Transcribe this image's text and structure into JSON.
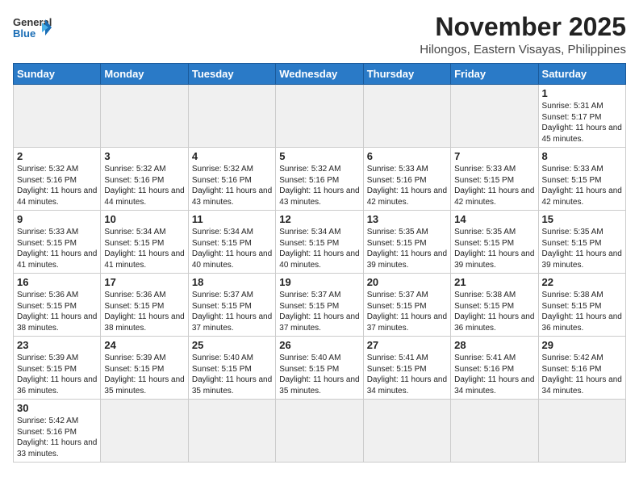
{
  "logo": {
    "general": "General",
    "blue": "Blue"
  },
  "title": "November 2025",
  "location": "Hilongos, Eastern Visayas, Philippines",
  "days_of_week": [
    "Sunday",
    "Monday",
    "Tuesday",
    "Wednesday",
    "Thursday",
    "Friday",
    "Saturday"
  ],
  "weeks": [
    [
      {
        "day": "",
        "empty": true
      },
      {
        "day": "",
        "empty": true
      },
      {
        "day": "",
        "empty": true
      },
      {
        "day": "",
        "empty": true
      },
      {
        "day": "",
        "empty": true
      },
      {
        "day": "",
        "empty": true
      },
      {
        "day": "1",
        "sunrise": "Sunrise: 5:31 AM",
        "sunset": "Sunset: 5:17 PM",
        "daylight": "Daylight: 11 hours and 45 minutes."
      }
    ],
    [
      {
        "day": "2",
        "sunrise": "Sunrise: 5:32 AM",
        "sunset": "Sunset: 5:16 PM",
        "daylight": "Daylight: 11 hours and 44 minutes."
      },
      {
        "day": "3",
        "sunrise": "Sunrise: 5:32 AM",
        "sunset": "Sunset: 5:16 PM",
        "daylight": "Daylight: 11 hours and 44 minutes."
      },
      {
        "day": "4",
        "sunrise": "Sunrise: 5:32 AM",
        "sunset": "Sunset: 5:16 PM",
        "daylight": "Daylight: 11 hours and 43 minutes."
      },
      {
        "day": "5",
        "sunrise": "Sunrise: 5:32 AM",
        "sunset": "Sunset: 5:16 PM",
        "daylight": "Daylight: 11 hours and 43 minutes."
      },
      {
        "day": "6",
        "sunrise": "Sunrise: 5:33 AM",
        "sunset": "Sunset: 5:16 PM",
        "daylight": "Daylight: 11 hours and 42 minutes."
      },
      {
        "day": "7",
        "sunrise": "Sunrise: 5:33 AM",
        "sunset": "Sunset: 5:15 PM",
        "daylight": "Daylight: 11 hours and 42 minutes."
      },
      {
        "day": "8",
        "sunrise": "Sunrise: 5:33 AM",
        "sunset": "Sunset: 5:15 PM",
        "daylight": "Daylight: 11 hours and 42 minutes."
      }
    ],
    [
      {
        "day": "9",
        "sunrise": "Sunrise: 5:33 AM",
        "sunset": "Sunset: 5:15 PM",
        "daylight": "Daylight: 11 hours and 41 minutes."
      },
      {
        "day": "10",
        "sunrise": "Sunrise: 5:34 AM",
        "sunset": "Sunset: 5:15 PM",
        "daylight": "Daylight: 11 hours and 41 minutes."
      },
      {
        "day": "11",
        "sunrise": "Sunrise: 5:34 AM",
        "sunset": "Sunset: 5:15 PM",
        "daylight": "Daylight: 11 hours and 40 minutes."
      },
      {
        "day": "12",
        "sunrise": "Sunrise: 5:34 AM",
        "sunset": "Sunset: 5:15 PM",
        "daylight": "Daylight: 11 hours and 40 minutes."
      },
      {
        "day": "13",
        "sunrise": "Sunrise: 5:35 AM",
        "sunset": "Sunset: 5:15 PM",
        "daylight": "Daylight: 11 hours and 39 minutes."
      },
      {
        "day": "14",
        "sunrise": "Sunrise: 5:35 AM",
        "sunset": "Sunset: 5:15 PM",
        "daylight": "Daylight: 11 hours and 39 minutes."
      },
      {
        "day": "15",
        "sunrise": "Sunrise: 5:35 AM",
        "sunset": "Sunset: 5:15 PM",
        "daylight": "Daylight: 11 hours and 39 minutes."
      }
    ],
    [
      {
        "day": "16",
        "sunrise": "Sunrise: 5:36 AM",
        "sunset": "Sunset: 5:15 PM",
        "daylight": "Daylight: 11 hours and 38 minutes."
      },
      {
        "day": "17",
        "sunrise": "Sunrise: 5:36 AM",
        "sunset": "Sunset: 5:15 PM",
        "daylight": "Daylight: 11 hours and 38 minutes."
      },
      {
        "day": "18",
        "sunrise": "Sunrise: 5:37 AM",
        "sunset": "Sunset: 5:15 PM",
        "daylight": "Daylight: 11 hours and 37 minutes."
      },
      {
        "day": "19",
        "sunrise": "Sunrise: 5:37 AM",
        "sunset": "Sunset: 5:15 PM",
        "daylight": "Daylight: 11 hours and 37 minutes."
      },
      {
        "day": "20",
        "sunrise": "Sunrise: 5:37 AM",
        "sunset": "Sunset: 5:15 PM",
        "daylight": "Daylight: 11 hours and 37 minutes."
      },
      {
        "day": "21",
        "sunrise": "Sunrise: 5:38 AM",
        "sunset": "Sunset: 5:15 PM",
        "daylight": "Daylight: 11 hours and 36 minutes."
      },
      {
        "day": "22",
        "sunrise": "Sunrise: 5:38 AM",
        "sunset": "Sunset: 5:15 PM",
        "daylight": "Daylight: 11 hours and 36 minutes."
      }
    ],
    [
      {
        "day": "23",
        "sunrise": "Sunrise: 5:39 AM",
        "sunset": "Sunset: 5:15 PM",
        "daylight": "Daylight: 11 hours and 36 minutes."
      },
      {
        "day": "24",
        "sunrise": "Sunrise: 5:39 AM",
        "sunset": "Sunset: 5:15 PM",
        "daylight": "Daylight: 11 hours and 35 minutes."
      },
      {
        "day": "25",
        "sunrise": "Sunrise: 5:40 AM",
        "sunset": "Sunset: 5:15 PM",
        "daylight": "Daylight: 11 hours and 35 minutes."
      },
      {
        "day": "26",
        "sunrise": "Sunrise: 5:40 AM",
        "sunset": "Sunset: 5:15 PM",
        "daylight": "Daylight: 11 hours and 35 minutes."
      },
      {
        "day": "27",
        "sunrise": "Sunrise: 5:41 AM",
        "sunset": "Sunset: 5:15 PM",
        "daylight": "Daylight: 11 hours and 34 minutes."
      },
      {
        "day": "28",
        "sunrise": "Sunrise: 5:41 AM",
        "sunset": "Sunset: 5:16 PM",
        "daylight": "Daylight: 11 hours and 34 minutes."
      },
      {
        "day": "29",
        "sunrise": "Sunrise: 5:42 AM",
        "sunset": "Sunset: 5:16 PM",
        "daylight": "Daylight: 11 hours and 34 minutes."
      }
    ],
    [
      {
        "day": "30",
        "sunrise": "Sunrise: 5:42 AM",
        "sunset": "Sunset: 5:16 PM",
        "daylight": "Daylight: 11 hours and 33 minutes."
      },
      {
        "day": "",
        "empty": true
      },
      {
        "day": "",
        "empty": true
      },
      {
        "day": "",
        "empty": true
      },
      {
        "day": "",
        "empty": true
      },
      {
        "day": "",
        "empty": true
      },
      {
        "day": "",
        "empty": true
      }
    ]
  ]
}
